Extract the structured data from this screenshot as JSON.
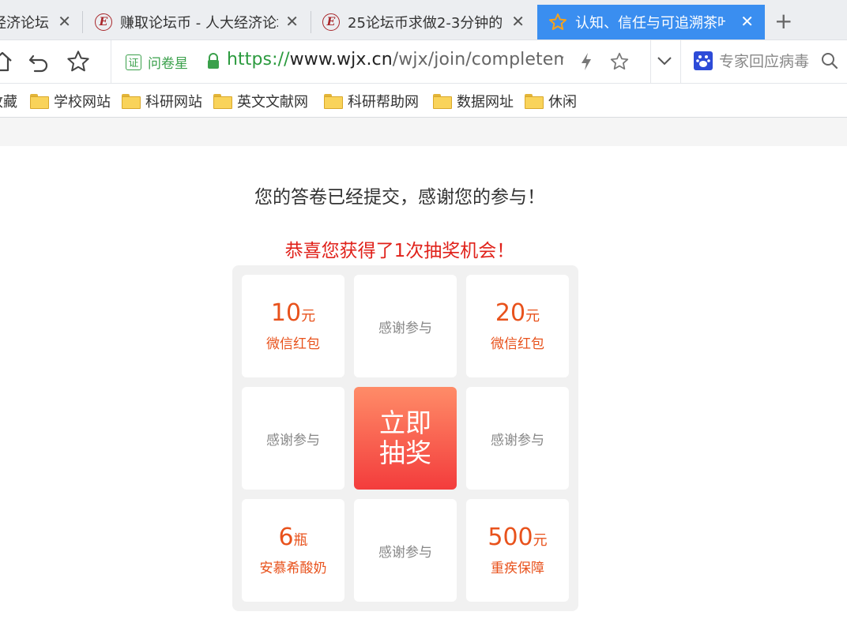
{
  "tabs": [
    {
      "title": "经济论坛",
      "active": false
    },
    {
      "title": "赚取论坛币 - 人大经济论坛",
      "active": false
    },
    {
      "title": "25论坛币求做2-3分钟的问卷",
      "active": false
    },
    {
      "title": "认知、信任与可追溯茶叶",
      "active": true
    }
  ],
  "close_glyph": "✕",
  "new_tab_glyph": "+",
  "address": {
    "cert_badge": "证",
    "cert_label": "问卷星",
    "scheme": "https://",
    "host": "www.wjx.cn",
    "path": "/wjx/join/completemob"
  },
  "search": {
    "placeholder": "专家回应病毒"
  },
  "bookmarks": [
    {
      "label": "收藏"
    },
    {
      "label": "学校网站"
    },
    {
      "label": "科研网站"
    },
    {
      "label": "英文文献网"
    },
    {
      "label": "科研帮助网"
    },
    {
      "label": "数据网址"
    },
    {
      "label": "休闲"
    }
  ],
  "page": {
    "submitted_text": "您的答卷已经提交，感谢您的参与！",
    "congrats_text": "恭喜您获得了1次抽奖机会！"
  },
  "lottery": {
    "thanks": "感谢参与",
    "draw_line1": "立即",
    "draw_line2": "抽奖",
    "prizes": [
      {
        "amount": "10",
        "unit": "元",
        "name": "微信红包"
      },
      {
        "amount": "20",
        "unit": "元",
        "name": "微信红包"
      },
      {
        "amount": "6",
        "unit": "瓶",
        "name": "安慕希酸奶"
      },
      {
        "amount": "500",
        "unit": "元",
        "name": "重疾保障"
      }
    ]
  },
  "colors": {
    "active_tab": "#3a8ef0",
    "prize": "#e8521c",
    "congrats": "#e0211a",
    "draw_top": "#ff8c68",
    "draw_bottom": "#f33c3c"
  },
  "icons": [
    "favicon-e-icon",
    "star-favicon-icon",
    "home-icon",
    "undo-icon",
    "bookmark-star-icon",
    "lock-icon",
    "lightning-icon",
    "star-icon",
    "chevron-down-icon",
    "baidu-paw-icon",
    "search-icon",
    "folder-icon"
  ]
}
